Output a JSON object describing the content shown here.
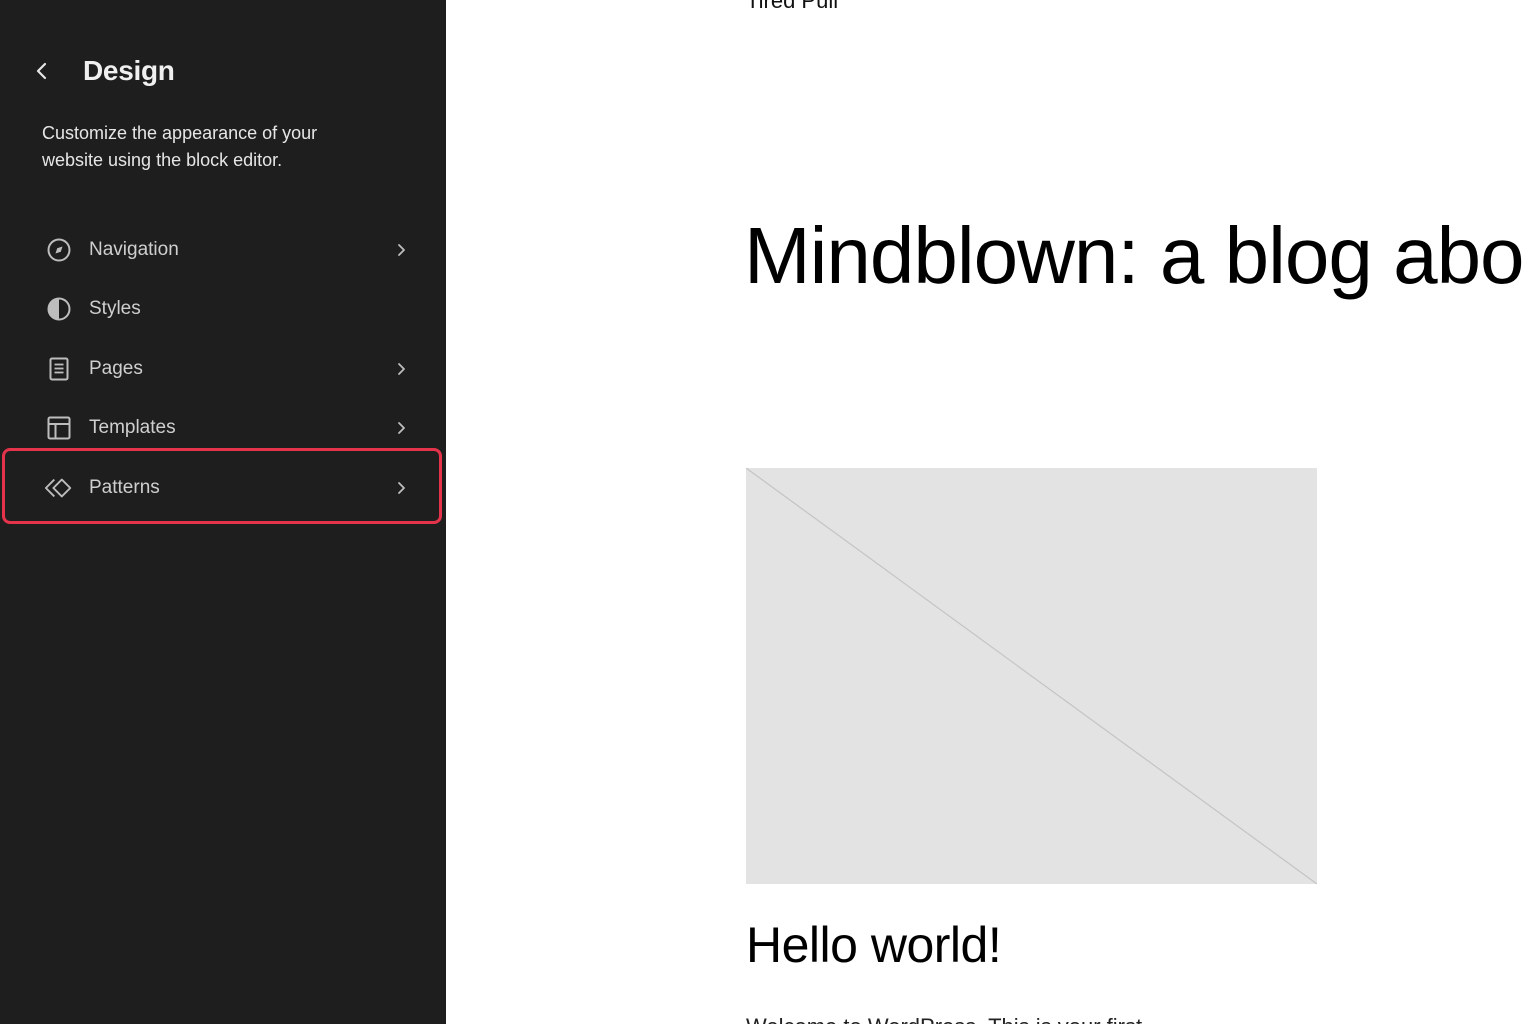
{
  "sidebar": {
    "title": "Design",
    "description": "Customize the appearance of your website using the block editor.",
    "items": [
      {
        "label": "Navigation",
        "icon": "compass-icon",
        "has_chevron": true
      },
      {
        "label": "Styles",
        "icon": "half-circle-icon",
        "has_chevron": false
      },
      {
        "label": "Pages",
        "icon": "page-icon",
        "has_chevron": true
      },
      {
        "label": "Templates",
        "icon": "layout-icon",
        "has_chevron": true
      },
      {
        "label": "Patterns",
        "icon": "diamond-pattern-icon",
        "has_chevron": true
      }
    ],
    "highlighted_item": "Patterns"
  },
  "content": {
    "site_title": "Tired Pull",
    "tagline": "Mindblown: a blog abo",
    "post_title": "Hello world!",
    "post_excerpt": "Welcome to WordPress. This is your first"
  },
  "colors": {
    "sidebar_bg": "#1e1e1e",
    "highlight": "#e5334b",
    "placeholder_bg": "#e3e3e3"
  }
}
